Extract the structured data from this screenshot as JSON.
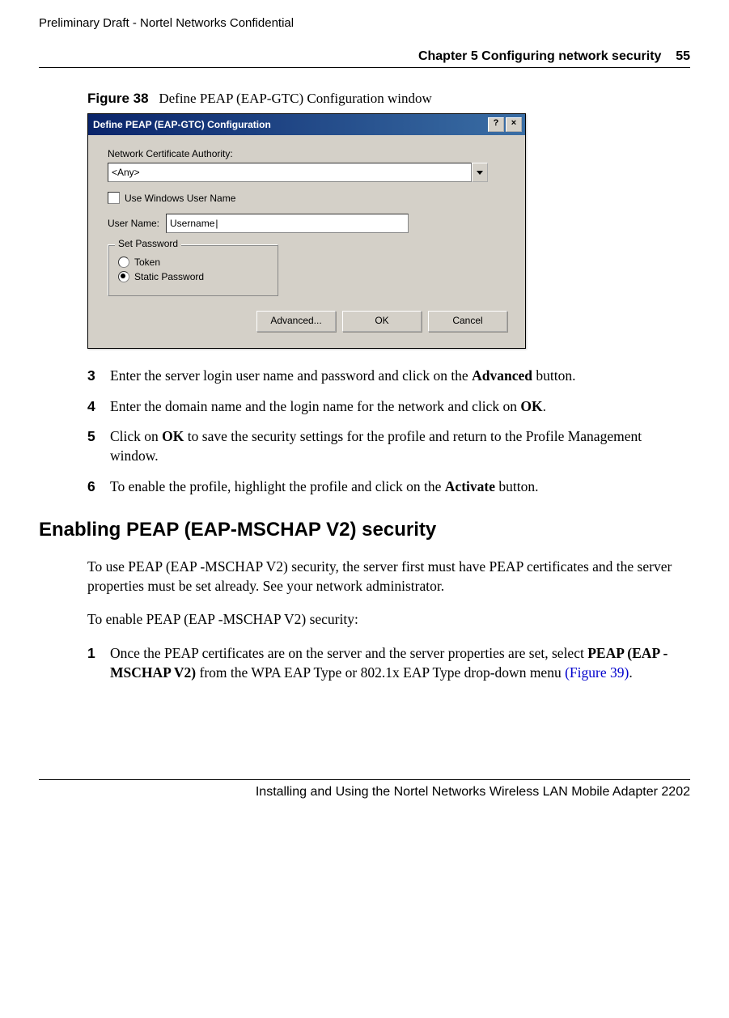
{
  "header": {
    "confidential": "Preliminary Draft - Nortel Networks Confidential",
    "chapter": "Chapter 5 Configuring network security",
    "page_number": "55"
  },
  "figure": {
    "label": "Figure 38",
    "caption": "Define PEAP (EAP-GTC) Configuration window"
  },
  "dialog": {
    "title": "Define PEAP (EAP-GTC) Configuration",
    "help_btn": "?",
    "close_btn": "×",
    "cert_auth_label": "Network Certificate Authority:",
    "cert_auth_value": "<Any>",
    "use_windows_user": "Use Windows User Name",
    "username_label": "User Name:",
    "username_value": "Username",
    "group_title": "Set Password",
    "radio_token": "Token",
    "radio_static": "Static Password",
    "btn_advanced": "Advanced...",
    "btn_ok": "OK",
    "btn_cancel": "Cancel"
  },
  "steps_a": {
    "s3_num": "3",
    "s3_text_a": "Enter the server login user name and password and click on the ",
    "s3_bold": "Advanced",
    "s3_text_b": " button.",
    "s4_num": "4",
    "s4_text_a": "Enter the domain name and the login name for the network and click on ",
    "s4_bold": "OK",
    "s4_text_b": ".",
    "s5_num": "5",
    "s5_text_a": "Click on ",
    "s5_bold": "OK",
    "s5_text_b": " to save the security settings for the profile and return to the Profile Management window.",
    "s6_num": "6",
    "s6_text_a": "To enable the profile, highlight the profile and click on the ",
    "s6_bold": "Activate",
    "s6_text_b": " button."
  },
  "section_heading": "Enabling PEAP (EAP-MSCHAP V2) security",
  "para1": "To use PEAP (EAP -MSCHAP V2) security, the server first must have PEAP certificates and the server properties must be set already. See your network administrator.",
  "para2": "To enable PEAP (EAP -MSCHAP V2) security:",
  "steps_b": {
    "s1_num": "1",
    "s1_text_a": "Once the PEAP certificates are on the server and the server properties are set, select ",
    "s1_bold": "PEAP (EAP -MSCHAP V2)",
    "s1_text_b": " from the WPA EAP Type or 802.1x EAP Type drop-down menu ",
    "s1_link": "(Figure 39)",
    "s1_text_c": "."
  },
  "footer": "Installing and Using the Nortel Networks Wireless LAN Mobile Adapter 2202"
}
